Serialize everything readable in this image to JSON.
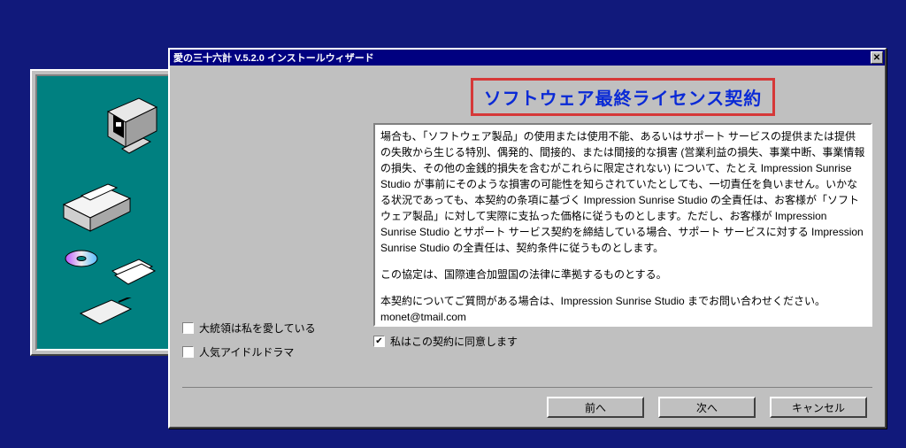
{
  "window": {
    "title": "愛の三十六計 V.5.2.0 インストールウィザード",
    "close_label": "✕"
  },
  "sidebar": {
    "checkboxes": [
      {
        "label": "大統領は私を愛している",
        "checked": false
      },
      {
        "label": "人気アイドルドラマ",
        "checked": false
      }
    ]
  },
  "license": {
    "heading": "ソフトウェア最終ライセンス契約",
    "body_paragraphs": [
      "場合も、「ソフトウェア製品」の使用または使用不能、あるいはサポート サービスの提供または提供の失敗から生じる特別、偶発的、間接的、または間接的な損害 (営業利益の損失、事業中断、事業情報の損失、その他の金銭的損失を含むがこれらに限定されない) について、たとえ Impression Sunrise Studio が事前にそのような損害の可能性を知らされていたとしても、一切責任を負いません。いかなる状況であっても、本契約の条項に基づく Impression Sunrise Studio の全責任は、お客様が「ソフトウェア製品」に対して実際に支払った価格に従うものとします。ただし、お客様が Impression Sunrise Studio とサポート サービス契約を締結している場合、サポート サービスに対する Impression Sunrise Studio の全責任は、契約条件に従うものとします。",
      "この協定は、国際連合加盟国の法律に準拠するものとする。",
      "本契約についてご質問がある場合は、Impression Sunrise Studio までお問い合わせください。monet@tmail.com"
    ],
    "agree_label": "私はこの契約に同意します",
    "agree_checked": true
  },
  "buttons": {
    "back": "前へ",
    "next": "次へ",
    "cancel": "キャンセル"
  },
  "icons": {
    "monitor": "monitor-icon",
    "printer": "printer-icon",
    "disc": "disc-icon",
    "paper": "paper-icon",
    "tablet": "tablet-icon"
  }
}
